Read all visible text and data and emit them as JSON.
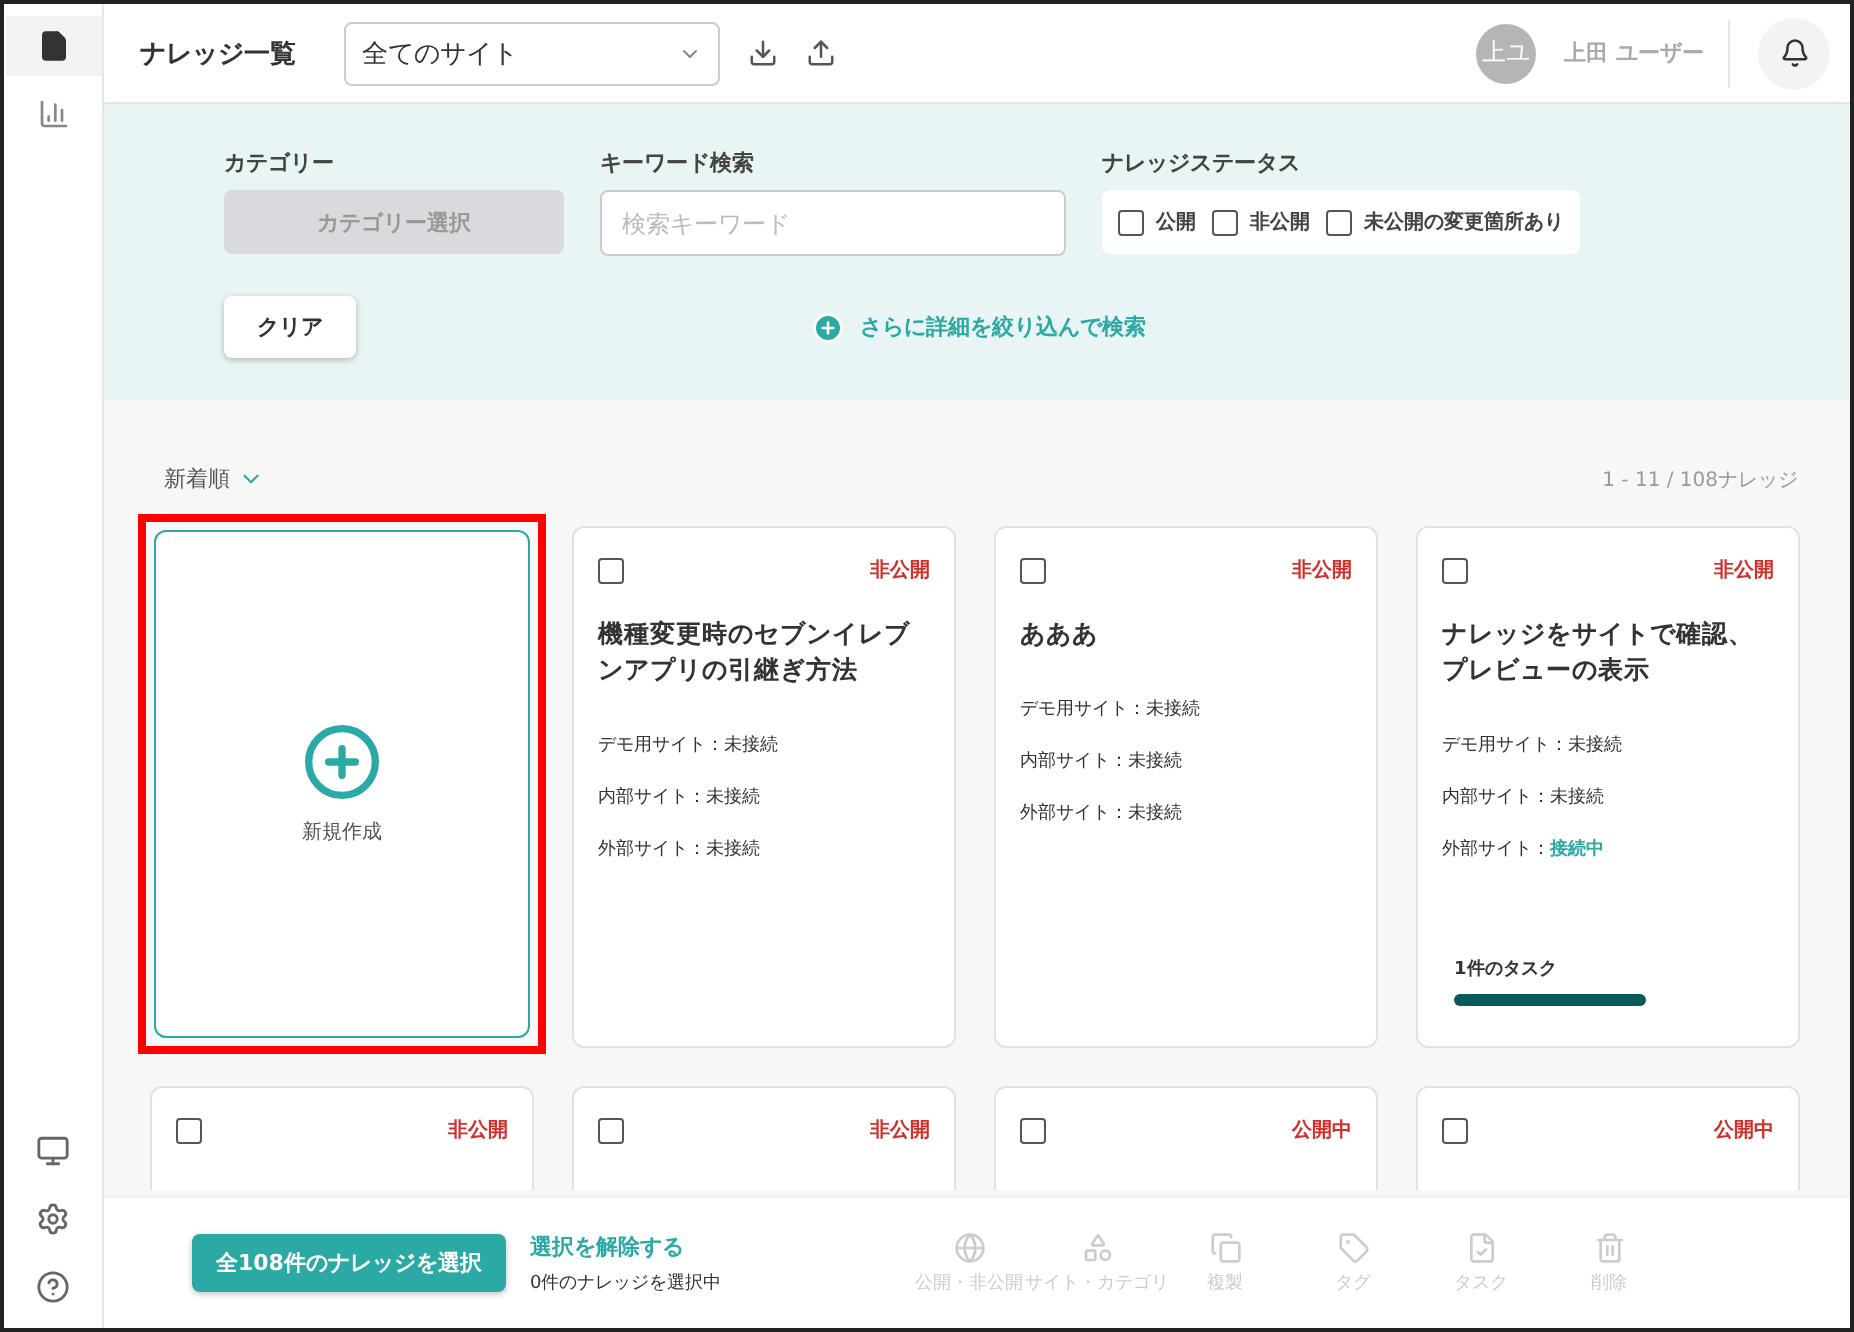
{
  "sidebar": {
    "top_items": [
      {
        "kind": "document",
        "selected": true
      },
      {
        "kind": "chart",
        "selected": false
      }
    ],
    "bottom_items": [
      {
        "kind": "monitor"
      },
      {
        "kind": "settings"
      },
      {
        "kind": "help"
      }
    ]
  },
  "header": {
    "title": "ナレッジ一覧",
    "site_select": {
      "value": "全てのサイト"
    },
    "avatar": "上ユ",
    "user_name": "上田 ユーザー"
  },
  "filters": {
    "category": {
      "label": "カテゴリー",
      "button": "カテゴリー選択",
      "disabled": true
    },
    "keyword": {
      "label": "キーワード検索",
      "placeholder": "検索キーワード"
    },
    "status": {
      "label": "ナレッジステータス",
      "options": [
        {
          "label": "公開",
          "checked": false
        },
        {
          "label": "非公開",
          "checked": false
        },
        {
          "label": "未公開の変更箇所あり",
          "checked": false
        }
      ]
    },
    "clear_button": "クリア",
    "advanced_link": "さらに詳細を絞り込んで検索"
  },
  "list": {
    "sort": "新着順",
    "count": "1 - 11 / 108ナレッジ",
    "create_card": {
      "label": "新規作成",
      "highlighted": true
    },
    "cards": [
      {
        "checked": false,
        "status": "非公開",
        "title": "機種変更時のセブンイレブンアプリの引継ぎ方法",
        "sites": [
          {
            "label": "デモ用サイト：",
            "value": "未接続",
            "connected": false
          },
          {
            "label": "内部サイト：",
            "value": "未接続",
            "connected": false
          },
          {
            "label": "外部サイト：",
            "value": "未接続",
            "connected": false
          }
        ]
      },
      {
        "checked": false,
        "status": "非公開",
        "title": "あああ",
        "sites": [
          {
            "label": "デモ用サイト：",
            "value": "未接続",
            "connected": false
          },
          {
            "label": "内部サイト：",
            "value": "未接続",
            "connected": false
          },
          {
            "label": "外部サイト：",
            "value": "未接続",
            "connected": false
          }
        ]
      },
      {
        "checked": false,
        "status": "非公開",
        "title": "ナレッジをサイトで確認、プレビューの表示",
        "sites": [
          {
            "label": "デモ用サイト：",
            "value": "未接続",
            "connected": false
          },
          {
            "label": "内部サイト：",
            "value": "未接続",
            "connected": false
          },
          {
            "label": "外部サイト：",
            "value": "接続中",
            "connected": true
          }
        ],
        "tasks": {
          "label": "1件のタスク",
          "level": 1
        }
      },
      {
        "checked": false,
        "status": "非公開"
      },
      {
        "checked": false,
        "status": "非公開"
      },
      {
        "checked": false,
        "status": "公開中"
      },
      {
        "checked": false,
        "status": "公開中"
      }
    ]
  },
  "bottom_bar": {
    "select_all": "全108件のナレッジを選択",
    "deselect": "選択を解除する",
    "selected_count": "0件のナレッジを選択中",
    "actions": [
      {
        "kind": "globe",
        "label": "公開・非公開",
        "disabled": true
      },
      {
        "kind": "shapes",
        "label": "サイト・カテゴリ",
        "disabled": true
      },
      {
        "kind": "copy",
        "label": "複製",
        "disabled": true
      },
      {
        "kind": "tag",
        "label": "タグ",
        "disabled": true
      },
      {
        "kind": "task",
        "label": "タスク",
        "disabled": true
      },
      {
        "kind": "delete",
        "label": "削除",
        "disabled": true
      }
    ]
  }
}
